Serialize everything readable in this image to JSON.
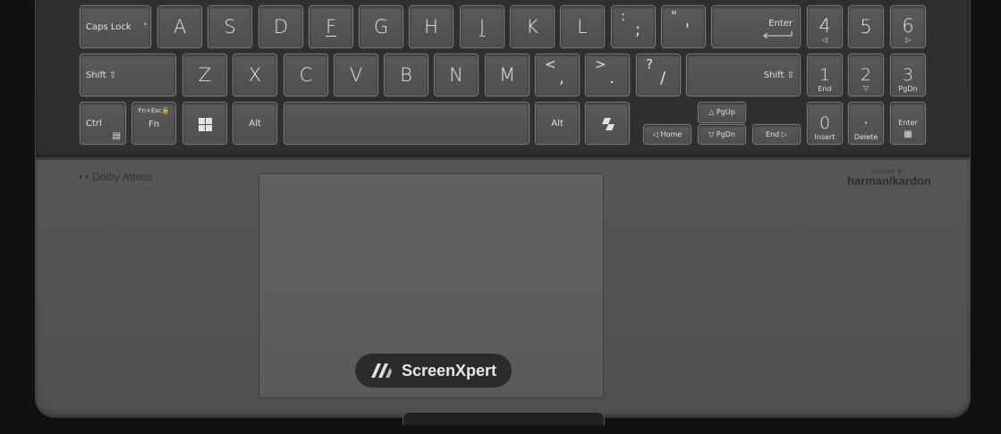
{
  "keys": {
    "caps_lock": "Caps Lock",
    "a": "A",
    "s": "S",
    "d": "D",
    "f": "F",
    "g": "G",
    "h": "H",
    "j": "J",
    "k": "K",
    "l": "L",
    "semicolon_top": ":",
    "semicolon_bottom": ";",
    "quote_top": "\"",
    "quote_bottom": "'",
    "enter": "Enter",
    "num4": "4",
    "num5": "5",
    "num6": "6",
    "shift_left": "Shift ⇧",
    "z": "Z",
    "x": "X",
    "c": "C",
    "v": "V",
    "b": "B",
    "n": "N",
    "m": "M",
    "comma_top": "<",
    "comma_bottom": ",",
    "period_top": ">",
    "period_bottom": ".",
    "slash_top": "?",
    "slash_bottom": "/",
    "shift_right": "Shift ⇧",
    "num1": "1",
    "num1_sub": "End",
    "num2": "2",
    "num3": "3",
    "num3_sub": "PgDn",
    "ctrl": "Ctrl",
    "fn_top": "Fn+Esc🔒",
    "fn": "Fn",
    "alt_left": "Alt",
    "alt_right": "Alt",
    "pgup": "△ PgUp",
    "home": "◁ Home",
    "pgdn": "▽ PgDn",
    "end": "End ▷",
    "num0": "0",
    "num0_sub": "Insert",
    "dot": "·",
    "dot_sub": "Delete",
    "num_enter": "Enter"
  },
  "branding": {
    "dolby": "Dolby Atmos",
    "harman_sound_by": "SOUND BY",
    "harman": "harman/kardon",
    "screenxpert": "ScreenXpert"
  },
  "colors": {
    "deck": "#585858",
    "pill": "#2b2b2b"
  }
}
